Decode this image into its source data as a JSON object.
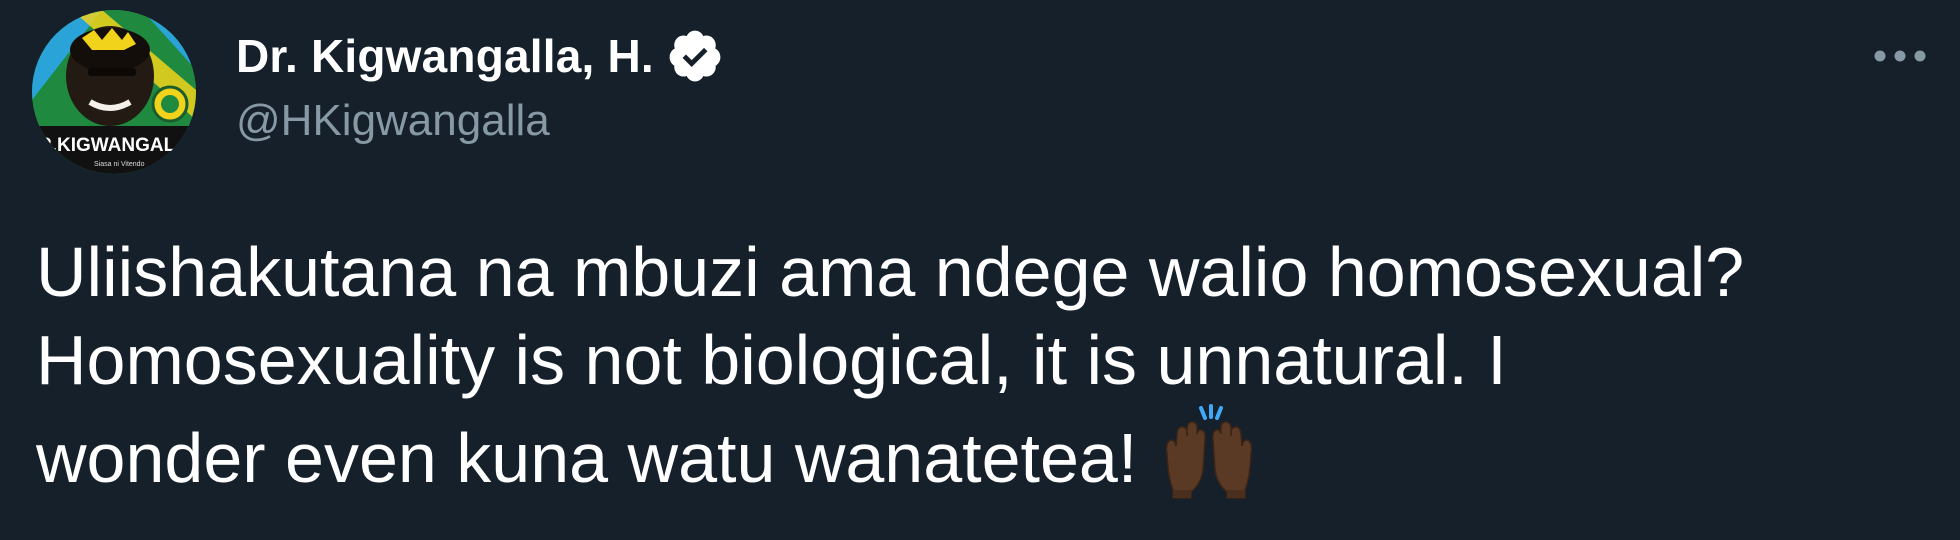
{
  "author": {
    "display_name": "Dr. Kigwangalla, H.",
    "handle": "@HKigwangalla",
    "verified": true,
    "avatar": {
      "banner_text": "R.KIGWANGAL",
      "slogan_text": "Siasa ni Vitendo",
      "background_color": "#1f7a3a",
      "accent_color": "#f2d31b"
    }
  },
  "tweet": {
    "lines": [
      "Uliishakutana na mbuzi ama ndege walio homosexual?",
      "Homosexuality is not biological, it is unnatural. I",
      "wonder even kuna watu wanatetea!"
    ],
    "emoji": "raising-hands-dark-skin-tone"
  },
  "icons": {
    "verified": "verified-badge-icon",
    "more": "more-options-icon"
  },
  "theme": {
    "background": "#15202b",
    "text_primary": "#ffffff",
    "text_secondary": "#8899a6"
  }
}
